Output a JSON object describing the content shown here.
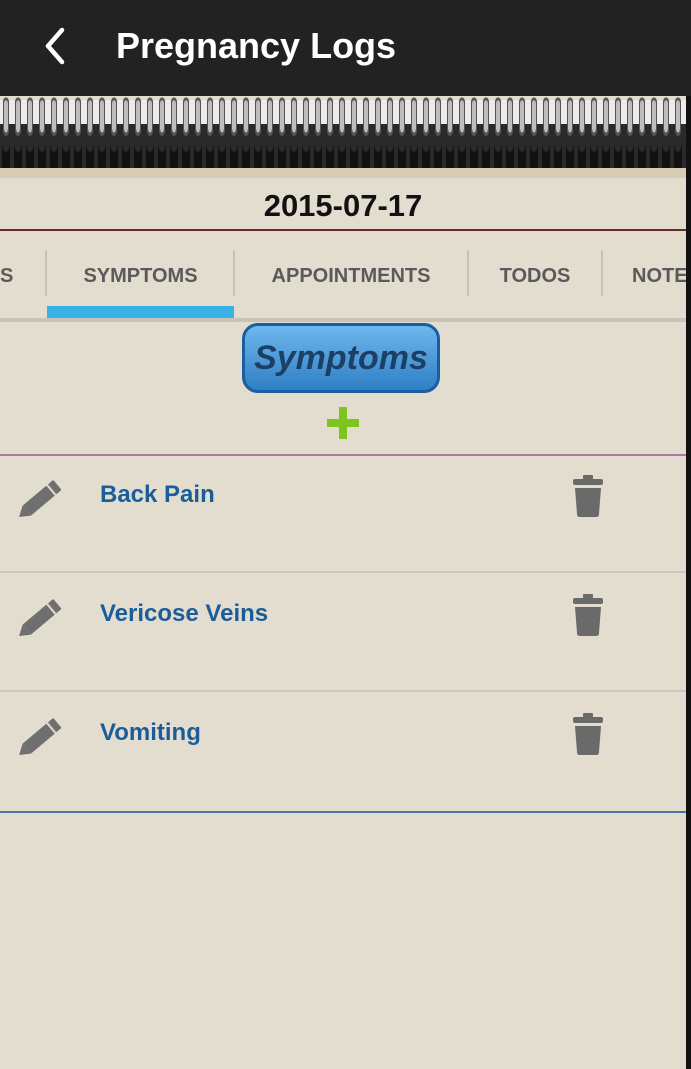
{
  "app_bar": {
    "title": "Pregnancy Logs",
    "back_icon": "chevron-left-icon"
  },
  "date": "2015-07-17",
  "tabs": [
    {
      "label": "S"
    },
    {
      "label": "SYMPTOMS",
      "selected": true
    },
    {
      "label": "APPOINTMENTS"
    },
    {
      "label": "TODOS"
    },
    {
      "label": "NOTE"
    }
  ],
  "section": {
    "button_label": "Symptoms",
    "add_icon": "plus-icon"
  },
  "symptoms": [
    {
      "name": "Back Pain"
    },
    {
      "name": "Vericose Veins"
    },
    {
      "name": "Vomiting"
    }
  ],
  "colors": {
    "app_bar": "#222222",
    "paper": "#e3ddd0",
    "tab_indicator": "#38b1e6",
    "item_text": "#1b5d99",
    "add_icon": "#7cc51c"
  }
}
